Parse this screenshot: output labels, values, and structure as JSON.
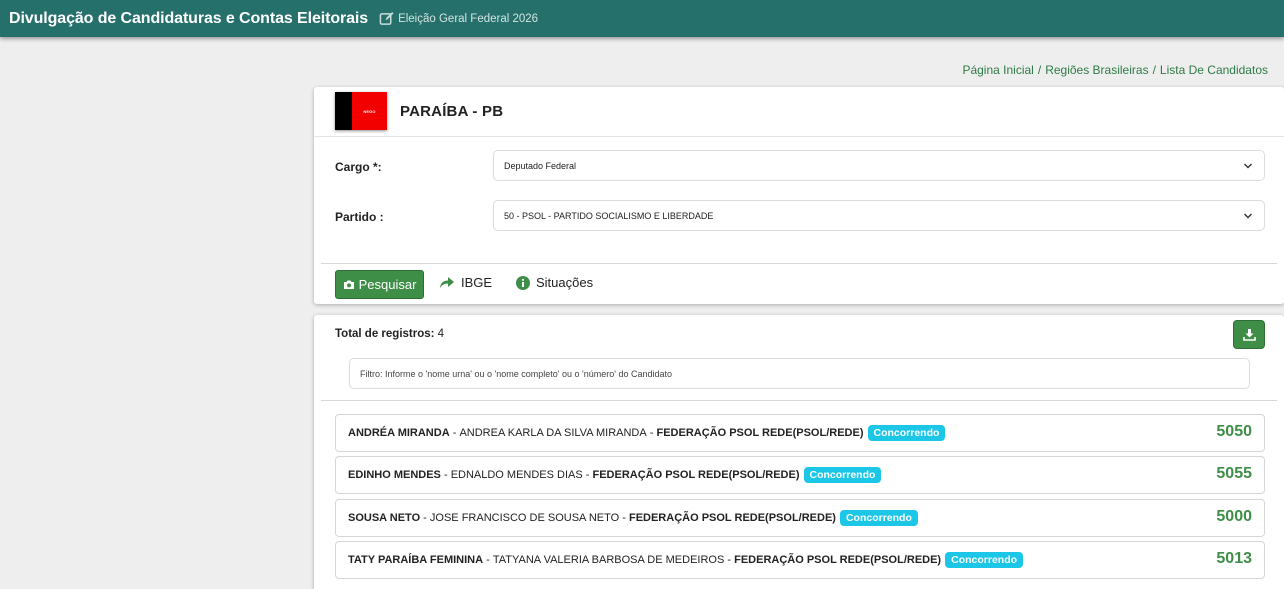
{
  "header": {
    "app_title": "Divulgação de Candidaturas e Contas Eleitorais",
    "election": "Eleição Geral Federal 2026"
  },
  "breadcrumb": [
    "Página Inicial",
    "Regiões Brasileiras",
    "Lista De Candidatos"
  ],
  "state": {
    "name": "PARAÍBA - PB",
    "flag_text": "NEGO",
    "flag_colors": {
      "left": "#000000",
      "right": "#f20000"
    }
  },
  "form": {
    "cargo_label": "Cargo *:",
    "cargo_value": "Deputado Federal",
    "partido_label": "Partido :",
    "partido_value": "50 - PSOL - PARTIDO SOCIALISMO E LIBERDADE"
  },
  "actions": {
    "search_label": "Pesquisar",
    "ibge_label": "IBGE",
    "situacoes_label": "Situações"
  },
  "results": {
    "total_label": "Total de registros:",
    "total_value": "4",
    "filter_placeholder": "Filtro: Informe o 'nome urna' ou o 'nome completo' ou o 'número' do Candidato",
    "candidates": [
      {
        "urna": "ANDRÉA MIRANDA",
        "full": "ANDREA KARLA DA SILVA MIRANDA",
        "party": "FEDERAÇÃO PSOL REDE(PSOL/REDE)",
        "status": "Concorrendo",
        "number": "5050"
      },
      {
        "urna": "EDINHO MENDES",
        "full": "EDNALDO MENDES DIAS",
        "party": "FEDERAÇÃO PSOL REDE(PSOL/REDE)",
        "status": "Concorrendo",
        "number": "5055"
      },
      {
        "urna": "SOUSA NETO",
        "full": "JOSE FRANCISCO DE SOUSA NETO",
        "party": "FEDERAÇÃO PSOL REDE(PSOL/REDE)",
        "status": "Concorrendo",
        "number": "5000"
      },
      {
        "urna": "TATY PARAÍBA FEMININA",
        "full": "TATYANA VALERIA BARBOSA DE MEDEIROS",
        "party": "FEDERAÇÃO PSOL REDE(PSOL/REDE)",
        "status": "Concorrendo",
        "number": "5013"
      }
    ],
    "separator": " - "
  },
  "colors": {
    "topbar": "#26706c",
    "accent_green": "#3e8e48",
    "badge": "#1cc6e6"
  }
}
